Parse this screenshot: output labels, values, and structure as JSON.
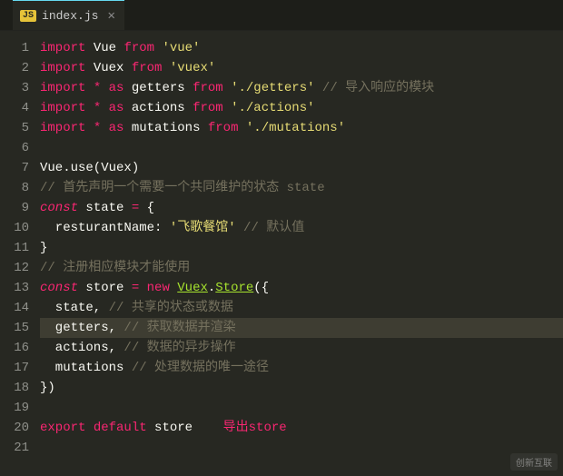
{
  "tab": {
    "icon": "JS",
    "filename": "index.js",
    "close_glyph": "✕"
  },
  "highlight_line": 15,
  "lines": [
    {
      "n": "1",
      "tokens": [
        {
          "c": "kw",
          "t": "import"
        },
        {
          "c": "ident",
          "t": " Vue "
        },
        {
          "c": "kw",
          "t": "from"
        },
        {
          "c": "ident",
          "t": " "
        },
        {
          "c": "str",
          "t": "'vue'"
        }
      ]
    },
    {
      "n": "2",
      "tokens": [
        {
          "c": "kw",
          "t": "import"
        },
        {
          "c": "ident",
          "t": " Vuex "
        },
        {
          "c": "kw",
          "t": "from"
        },
        {
          "c": "ident",
          "t": " "
        },
        {
          "c": "str",
          "t": "'vuex'"
        }
      ]
    },
    {
      "n": "3",
      "tokens": [
        {
          "c": "kw",
          "t": "import"
        },
        {
          "c": "ident",
          "t": " "
        },
        {
          "c": "op",
          "t": "*"
        },
        {
          "c": "ident",
          "t": " "
        },
        {
          "c": "kw",
          "t": "as"
        },
        {
          "c": "ident",
          "t": " getters "
        },
        {
          "c": "kw",
          "t": "from"
        },
        {
          "c": "ident",
          "t": " "
        },
        {
          "c": "str",
          "t": "'./getters'"
        },
        {
          "c": "ident",
          "t": " "
        },
        {
          "c": "comment",
          "t": "// 导入响应的模块"
        }
      ]
    },
    {
      "n": "4",
      "tokens": [
        {
          "c": "kw",
          "t": "import"
        },
        {
          "c": "ident",
          "t": " "
        },
        {
          "c": "op",
          "t": "*"
        },
        {
          "c": "ident",
          "t": " "
        },
        {
          "c": "kw",
          "t": "as"
        },
        {
          "c": "ident",
          "t": " actions "
        },
        {
          "c": "kw",
          "t": "from"
        },
        {
          "c": "ident",
          "t": " "
        },
        {
          "c": "str",
          "t": "'./actions'"
        }
      ]
    },
    {
      "n": "5",
      "tokens": [
        {
          "c": "kw",
          "t": "import"
        },
        {
          "c": "ident",
          "t": " "
        },
        {
          "c": "op",
          "t": "*"
        },
        {
          "c": "ident",
          "t": " "
        },
        {
          "c": "kw",
          "t": "as"
        },
        {
          "c": "ident",
          "t": " mutations "
        },
        {
          "c": "kw",
          "t": "from"
        },
        {
          "c": "ident",
          "t": " "
        },
        {
          "c": "str",
          "t": "'./mutations'"
        }
      ]
    },
    {
      "n": "6",
      "tokens": []
    },
    {
      "n": "7",
      "tokens": [
        {
          "c": "ident",
          "t": "Vue.use(Vuex)"
        }
      ]
    },
    {
      "n": "8",
      "tokens": [
        {
          "c": "comment",
          "t": "// 首先声明一个需要一个共同维护的状态 state"
        }
      ]
    },
    {
      "n": "9",
      "tokens": [
        {
          "c": "kw-em",
          "t": "const"
        },
        {
          "c": "ident",
          "t": " state "
        },
        {
          "c": "op",
          "t": "="
        },
        {
          "c": "ident",
          "t": " {"
        }
      ]
    },
    {
      "n": "10",
      "tokens": [
        {
          "c": "ident",
          "t": "  resturantName: "
        },
        {
          "c": "str",
          "t": "'飞歌餐馆'"
        },
        {
          "c": "ident",
          "t": " "
        },
        {
          "c": "comment",
          "t": "// 默认值"
        }
      ]
    },
    {
      "n": "11",
      "tokens": [
        {
          "c": "ident",
          "t": "}"
        }
      ]
    },
    {
      "n": "12",
      "tokens": [
        {
          "c": "comment",
          "t": "// 注册相应模块才能使用"
        }
      ]
    },
    {
      "n": "13",
      "tokens": [
        {
          "c": "kw-em",
          "t": "const"
        },
        {
          "c": "ident",
          "t": " store "
        },
        {
          "c": "op",
          "t": "="
        },
        {
          "c": "ident",
          "t": " "
        },
        {
          "c": "kw",
          "t": "new"
        },
        {
          "c": "ident",
          "t": " "
        },
        {
          "c": "class",
          "t": "Vuex"
        },
        {
          "c": "ident",
          "t": "."
        },
        {
          "c": "class",
          "t": "Store"
        },
        {
          "c": "ident",
          "t": "({"
        }
      ]
    },
    {
      "n": "14",
      "tokens": [
        {
          "c": "ident",
          "t": "  state, "
        },
        {
          "c": "comment",
          "t": "// 共享的状态或数据"
        }
      ]
    },
    {
      "n": "15",
      "tokens": [
        {
          "c": "ident",
          "t": "  getters, "
        },
        {
          "c": "comment",
          "t": "// 获取数据并渲染"
        }
      ]
    },
    {
      "n": "16",
      "tokens": [
        {
          "c": "ident",
          "t": "  actions, "
        },
        {
          "c": "comment",
          "t": "// 数据的异步操作"
        }
      ]
    },
    {
      "n": "17",
      "tokens": [
        {
          "c": "ident",
          "t": "  mutations "
        },
        {
          "c": "comment",
          "t": "// 处理数据的唯一途径"
        }
      ]
    },
    {
      "n": "18",
      "tokens": [
        {
          "c": "ident",
          "t": "})"
        }
      ]
    },
    {
      "n": "19",
      "tokens": []
    },
    {
      "n": "20",
      "tokens": [
        {
          "c": "kw",
          "t": "export"
        },
        {
          "c": "ident",
          "t": " "
        },
        {
          "c": "kw",
          "t": "default"
        },
        {
          "c": "ident",
          "t": " store    "
        },
        {
          "c": "red",
          "t": "导出store"
        }
      ]
    },
    {
      "n": "21",
      "tokens": []
    }
  ],
  "watermark": "创新互联"
}
